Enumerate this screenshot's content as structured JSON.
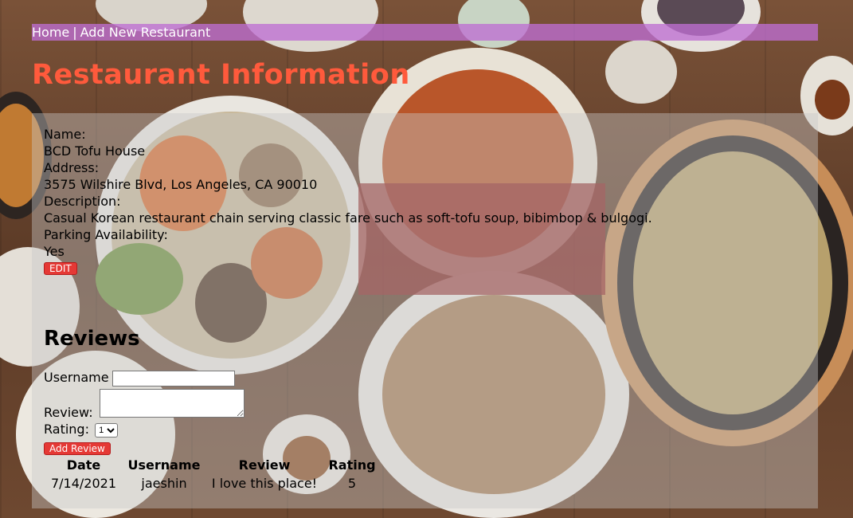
{
  "nav": {
    "home_label": "Home",
    "separator": "|",
    "add_label": "Add New Restaurant"
  },
  "page_title": "Restaurant Information",
  "restaurant": {
    "name_label": "Name:",
    "name": "BCD Tofu House",
    "address_label": "Address:",
    "address": "3575 Wilshire Blvd, Los Angeles, CA 90010",
    "description_label": "Description:",
    "description": "Casual Korean restaurant chain serving classic fare such as soft-tofu soup, bibimbop & bulgogi.",
    "parking_label": "Parking Availability:",
    "parking": "Yes",
    "edit_label": "EDIT"
  },
  "reviews": {
    "heading": "Reviews",
    "username_label": "Username",
    "username_value": "",
    "review_label": "Review:",
    "review_value": "",
    "rating_label": "Rating:",
    "rating_selected": "1",
    "add_label": "Add Review",
    "columns": [
      "Date",
      "Username",
      "Review",
      "Rating"
    ],
    "rows": [
      {
        "date": "7/14/2021",
        "username": "jaeshin",
        "review": "I love this place!",
        "rating": "5"
      }
    ]
  },
  "colors": {
    "title": "#ff5a3c",
    "nav_bar": "#be6ed2",
    "button": "#e53935"
  }
}
